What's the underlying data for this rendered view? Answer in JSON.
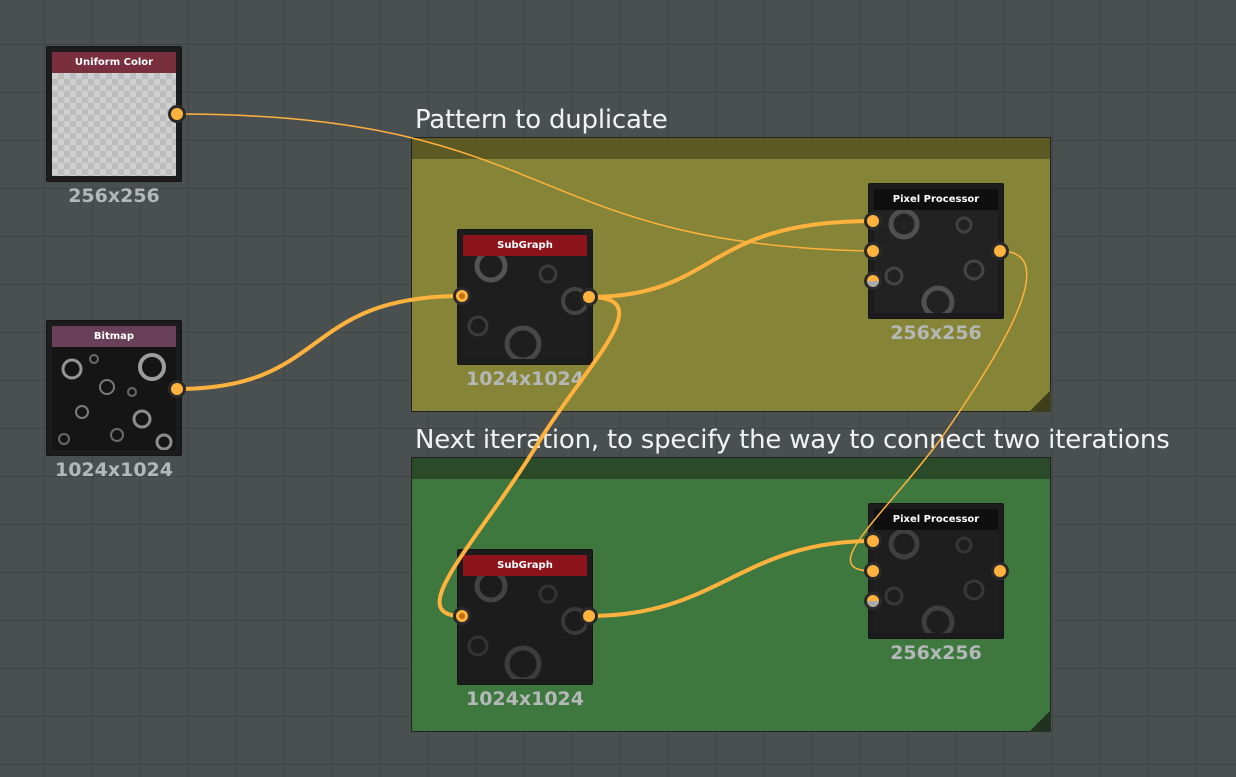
{
  "frames": {
    "pattern": {
      "title": "Pattern to duplicate",
      "color": "#868436",
      "header_color": "#5d5922"
    },
    "next": {
      "title": "Next iteration, to specify the way to connect two iterations",
      "color": "#3e783e",
      "header_color": "#2a4a2a"
    }
  },
  "nodes": {
    "uniform_color": {
      "title": "Uniform Color",
      "resolution": "256x256",
      "header_color": "#7a2f3e"
    },
    "bitmap": {
      "title": "Bitmap",
      "resolution": "1024x1024",
      "header_color": "#6a3f5a"
    },
    "subgraph_1": {
      "title": "SubGraph",
      "resolution": "1024x1024",
      "header_color": "#8e141b"
    },
    "pixel_processor_1": {
      "title": "Pixel Processor",
      "resolution": "256x256",
      "header_color": "#0f0f0f"
    },
    "subgraph_2": {
      "title": "SubGraph",
      "resolution": "1024x1024",
      "header_color": "#8e141b"
    },
    "pixel_processor_2": {
      "title": "Pixel Processor",
      "resolution": "256x256",
      "header_color": "#0f0f0f"
    }
  },
  "colors": {
    "wire": "#ffb23d",
    "port": "#ffb23d",
    "grid_background": "#4a5050"
  }
}
